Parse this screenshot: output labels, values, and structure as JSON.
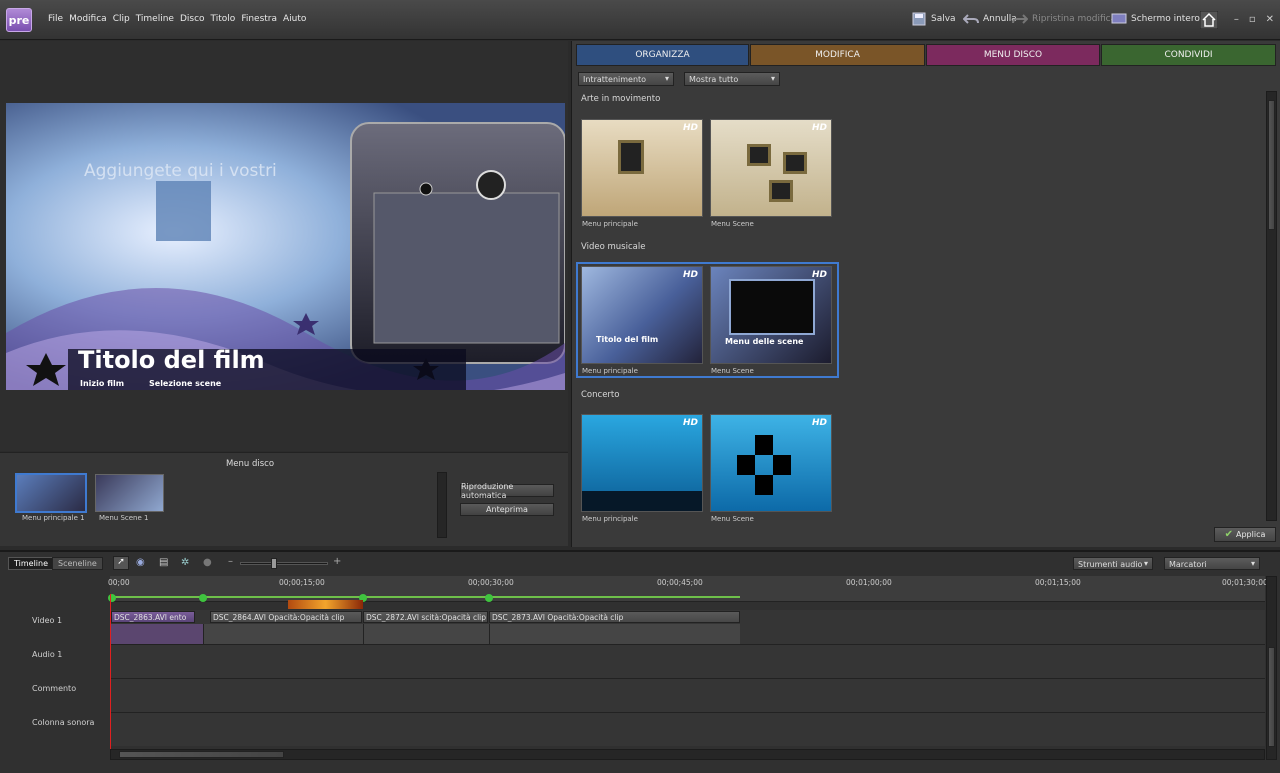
{
  "app": {
    "logo": "pre"
  },
  "menubar": [
    "File",
    "Modifica",
    "Clip",
    "Timeline",
    "Disco",
    "Titolo",
    "Finestra",
    "Aiuto"
  ],
  "toolbar": {
    "save": "Salva",
    "undo": "Annulla",
    "redo": "Ripristina modifica",
    "fullscreen": "Schermo intero"
  },
  "preview": {
    "title": "Titolo del film",
    "placeholder": "Aggiungete qui i vostri",
    "link1": "Inizio film",
    "link2": "Selezione scene"
  },
  "menu_disco_panel": {
    "heading": "Menu disco",
    "items": [
      "Menu principale 1",
      "Menu Scene 1"
    ],
    "auto_play": "Riproduzione automatica",
    "preview_btn": "Anteprima"
  },
  "tabs": [
    {
      "label": "ORGANIZZA",
      "color": "#2f4f7f"
    },
    {
      "label": "MODIFICA",
      "color": "#7a5528"
    },
    {
      "label": "MENU DISCO",
      "color": "#7c2a5e"
    },
    {
      "label": "CONDIVIDI",
      "color": "#3a6630"
    }
  ],
  "filters": {
    "category": "Intrattenimento",
    "show": "Mostra tutto"
  },
  "sections": [
    {
      "name": "Arte in movimento",
      "thumbs": [
        "Menu principale",
        "Menu Scene"
      ]
    },
    {
      "name": "Video musicale",
      "thumbs": [
        "Menu principale",
        "Menu Scene"
      ],
      "thumb_text": [
        "Titolo del film",
        "Menu delle scene"
      ]
    },
    {
      "name": "Concerto",
      "thumbs": [
        "Menu principale",
        "Menu Scene"
      ]
    }
  ],
  "hd_badge": "HD",
  "apply": "Applica",
  "timeline": {
    "tabs": [
      "Timeline",
      "Sceneline"
    ],
    "audio_tools": "Strumenti audio",
    "markers": "Marcatori",
    "ruler": [
      "00;00",
      "00;00;15;00",
      "00;00;30;00",
      "00;00;45;00",
      "00;01;00;00",
      "00;01;15;00",
      "00;01;30;00"
    ],
    "tracks": [
      "Video 1",
      "Audio 1",
      "Commento",
      "Colonna sonora"
    ],
    "clips": [
      {
        "name": "DSC_2863.AVI",
        "fx": "ento"
      },
      {
        "name": "DSC_2864.AVI",
        "fx": "Opacità:Opacità clip"
      },
      {
        "name": "DSC_2872.AVI",
        "fx": "scità:Opacità clip"
      },
      {
        "name": "DSC_2873.AVI",
        "fx": "Opacità:Opacità clip"
      }
    ]
  }
}
